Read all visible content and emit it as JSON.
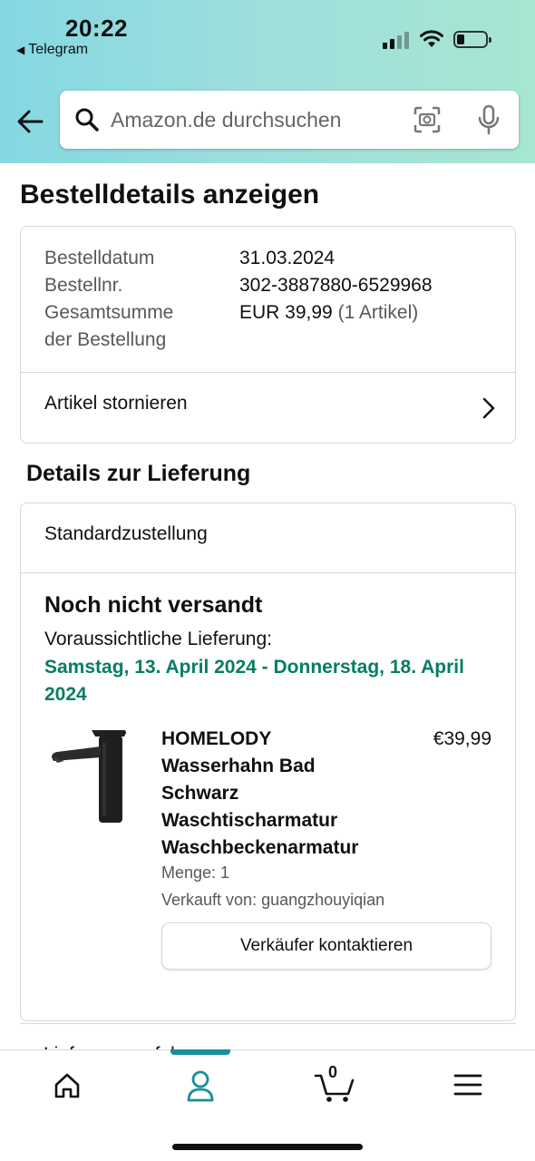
{
  "status_bar": {
    "time": "20:22",
    "back_app": "Telegram"
  },
  "search": {
    "placeholder": "Amazon.de durchsuchen"
  },
  "page_title": "Bestelldetails anzeigen",
  "order_summary": {
    "date_label": "Bestelldatum",
    "date_value": "31.03.2024",
    "number_label": "Bestellnr.",
    "number_value": "302-3887880-6529968",
    "total_label_line1": "Gesamtsumme",
    "total_label_line2": "der Bestellung",
    "total_value": "EUR 39,99",
    "total_items": "(1 Artikel)",
    "cancel_link": "Artikel stornieren"
  },
  "delivery": {
    "section_title": "Details zur Lieferung",
    "method": "Standardzustellung",
    "status": "Noch nicht versandt",
    "estimate_label": "Voraussichtliche Lieferung:",
    "estimate_dates": "Samstag, 13. April 2024 - Donnerstag, 18. April 2024",
    "product": {
      "title": "HOMELODY Wasserhahn Bad Schwarz Waschtischarmatur Waschbeckenarmatur",
      "price": "€39,99",
      "quantity": "Menge: 1",
      "seller": "Verkauft von: guangzhouyiqian",
      "contact_button": "Verkäufer kontaktieren"
    }
  },
  "next_row_partial": "Lieferung verfolgen",
  "bottom_nav": {
    "active": "account",
    "cart_count": "0",
    "items": [
      "home",
      "account",
      "cart",
      "menu"
    ]
  },
  "colors": {
    "accent": "#1a8d9b",
    "delivery_green": "#067d62",
    "header_from": "#84d8e3",
    "header_to": "#a7e6d2"
  },
  "icons": [
    "back-arrow-icon",
    "search-icon",
    "camera-icon",
    "mic-icon",
    "chevron-right-icon",
    "home-icon",
    "account-icon",
    "cart-icon",
    "menu-icon"
  ]
}
